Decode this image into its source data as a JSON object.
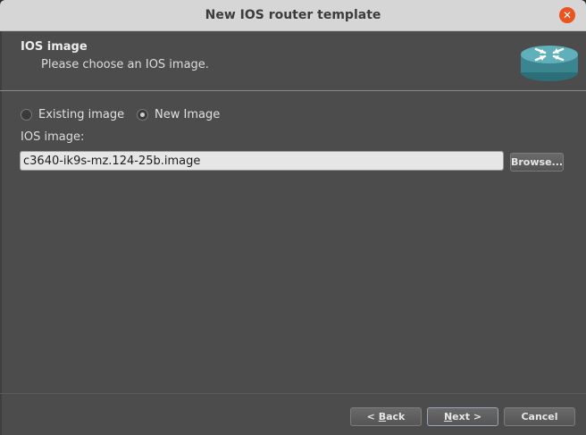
{
  "window": {
    "title": "New IOS router template",
    "close_symbol": "✕"
  },
  "header": {
    "title": "IOS image",
    "subtitle": "Please choose an IOS image.",
    "logo_icon": "router-icon"
  },
  "image_source": {
    "options": [
      {
        "label": "Existing image",
        "checked": false
      },
      {
        "label": "New Image",
        "checked": true
      }
    ]
  },
  "ios_image": {
    "label": "IOS image:",
    "value": "c3640-ik9s-mz.124-25b.image",
    "browse_label": "Browse..."
  },
  "footer": {
    "back_prefix": "< ",
    "back_mnemonic": "B",
    "back_rest": "ack",
    "next_mnemonic": "N",
    "next_rest": "ext >",
    "cancel_label": "Cancel"
  },
  "colors": {
    "window_bg": "#4c4c4c",
    "titlebar_bg": "#d6d6d6",
    "close_button": "#e95420",
    "router_icon": "#3f8e9a"
  }
}
